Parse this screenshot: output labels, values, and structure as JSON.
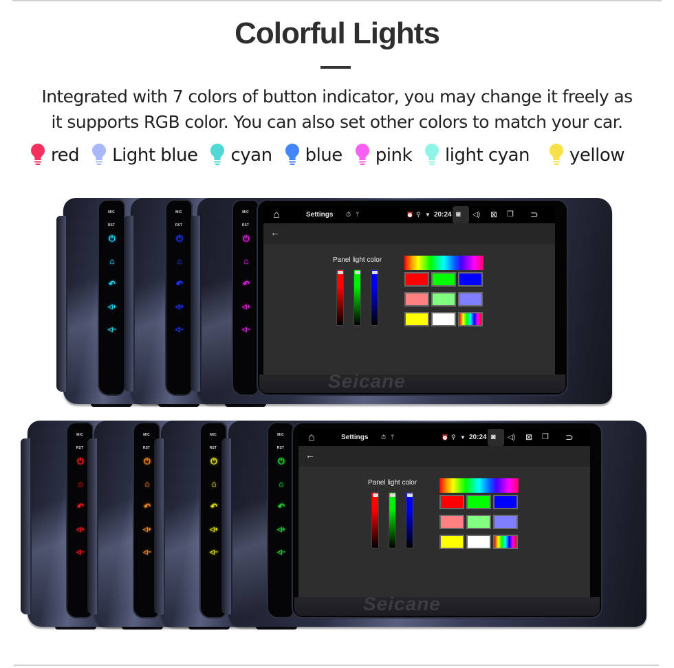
{
  "header": {
    "title": "Colorful Lights",
    "description_line1": "Integrated with 7 colors of button indicator, you may change it freely as",
    "description_line2": "it supports RGB color. You can also set other colors to match your car."
  },
  "legend": [
    {
      "label": "red",
      "color": "#f5305f",
      "icon": "bulb-icon"
    },
    {
      "label": "Light blue",
      "color": "#a8b8f8",
      "icon": "bulb-icon"
    },
    {
      "label": "cyan",
      "color": "#4fd9d5",
      "icon": "bulb-icon"
    },
    {
      "label": "blue",
      "color": "#4287f5",
      "icon": "bulb-icon"
    },
    {
      "label": "pink",
      "color": "#f760f0",
      "icon": "bulb-icon"
    },
    {
      "label": "light cyan",
      "color": "#8ef5e6",
      "icon": "bulb-icon"
    },
    {
      "label": "yellow",
      "color": "#f5e24a",
      "icon": "bulb-icon"
    }
  ],
  "devices": {
    "strip_labels": {
      "mic": "MIC",
      "rst": "RST"
    },
    "button_icons": [
      "power-icon",
      "home-icon",
      "back-icon",
      "volume-up-icon",
      "volume-down-icon"
    ],
    "top_row_colors": [
      "#22d4ee",
      "#2233ff",
      "#e020e0"
    ],
    "bottom_row_colors": [
      "#ff1a1a",
      "#ff8a1a",
      "#e8e81a",
      "#22dd33"
    ],
    "brand": "Seicane"
  },
  "screen": {
    "status_title": "Settings",
    "time": "20:24",
    "status_icons": [
      "home-icon",
      "timer-icon",
      "usb-icon",
      "alarm-icon",
      "location-icon",
      "wifi-icon",
      "camera-icon",
      "volume-icon",
      "close-window-icon",
      "recent-apps-icon",
      "return-icon"
    ],
    "back_icon": "arrow-left-icon",
    "panel_label": "Panel light color",
    "sliders": [
      {
        "channel": "red",
        "color": "#ff0000",
        "value": 1.0
      },
      {
        "channel": "green",
        "color": "#00ee00",
        "value": 1.0
      },
      {
        "channel": "blue",
        "color": "#0000ee",
        "value": 1.0
      }
    ],
    "swatches": [
      "#ff0000",
      "#00ff00",
      "#0000ff",
      "#ff8080",
      "#80ff80",
      "#8080ff",
      "#ffff00",
      "#ffffff",
      "rainbow"
    ]
  }
}
